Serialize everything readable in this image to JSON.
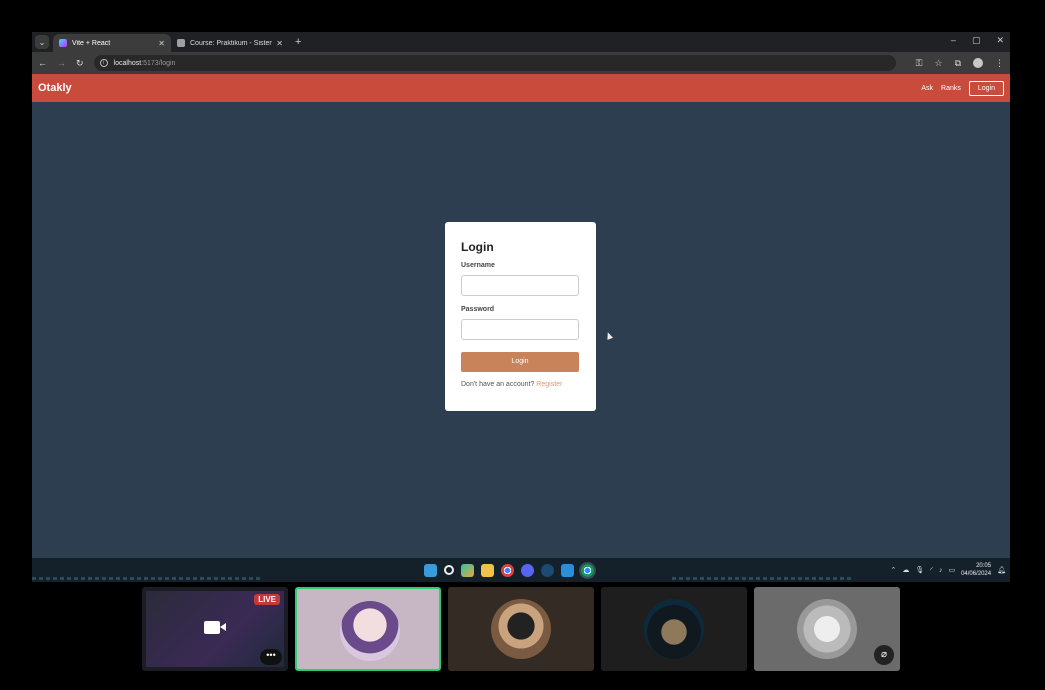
{
  "browser": {
    "tabs": [
      {
        "title": "Vite + React",
        "active": true
      },
      {
        "title": "Course: Praktikum - Sistem Ba…",
        "active": false
      }
    ],
    "new_tab": "+",
    "url_host": "localhost",
    "url_path": ":5173/login",
    "window_controls": [
      "–",
      "▢",
      "✕"
    ]
  },
  "navbar": {
    "brand": "Otakly",
    "links": [
      "Ask",
      "Ranks"
    ],
    "login_button": "Login"
  },
  "login_card": {
    "title": "Login",
    "username_label": "Username",
    "username_value": "",
    "password_label": "Password",
    "password_value": "",
    "submit_label": "Login",
    "register_prompt": "Don't have an account?",
    "register_link": "Register"
  },
  "taskbar": {
    "time": "20:05",
    "date": "04/06/2024",
    "app_icons": [
      "windows-icon",
      "search-icon",
      "copilot-icon",
      "file-explorer-icon",
      "chrome-icon",
      "discord-icon",
      "steam-icon",
      "vscode-icon",
      "chrome-active-icon"
    ]
  },
  "call": {
    "live_badge": "LIVE",
    "more_label": "•••",
    "participants": [
      "screen-share",
      "participant-1",
      "participant-2",
      "participant-3",
      "participant-4"
    ]
  },
  "colors": {
    "navbar": "#c84b3c",
    "app_bg": "#2c3e50",
    "login_button": "#c9835a",
    "register_link": "#d89a6c",
    "speaking_border": "#2ecc71"
  }
}
